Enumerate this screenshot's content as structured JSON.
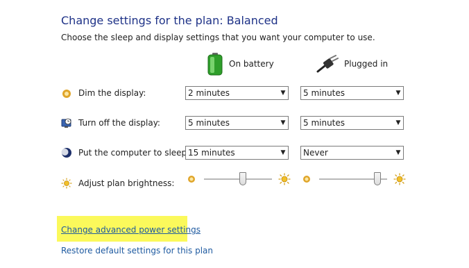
{
  "header": {
    "title": "Change settings for the plan: Balanced",
    "subtitle": "Choose the sleep and display settings that you want your computer to use."
  },
  "columns": {
    "battery": {
      "label": "On battery",
      "icon": "battery-icon"
    },
    "plugged": {
      "label": "Plugged in",
      "icon": "power-plug-icon"
    }
  },
  "rows": {
    "dim": {
      "label": "Dim the display:",
      "battery": "2 minutes",
      "plugged": "5 minutes",
      "icon": "dim-display-icon"
    },
    "off": {
      "label": "Turn off the display:",
      "battery": "5 minutes",
      "plugged": "5 minutes",
      "icon": "monitor-clock-icon"
    },
    "sleep": {
      "label": "Put the computer to sleep:",
      "battery": "15 minutes",
      "plugged": "Never",
      "icon": "sleep-moon-icon"
    },
    "brightness": {
      "label": "Adjust plan brightness:",
      "battery_level_pct": 58,
      "plugged_level_pct": 90,
      "icon": "brightness-sun-icon"
    }
  },
  "links": {
    "advanced": "Change advanced power settings",
    "restore": "Restore default settings for this plan"
  },
  "colors": {
    "title": "#1e3287",
    "link": "#1e5aa0",
    "highlight": "#fbf95b"
  }
}
